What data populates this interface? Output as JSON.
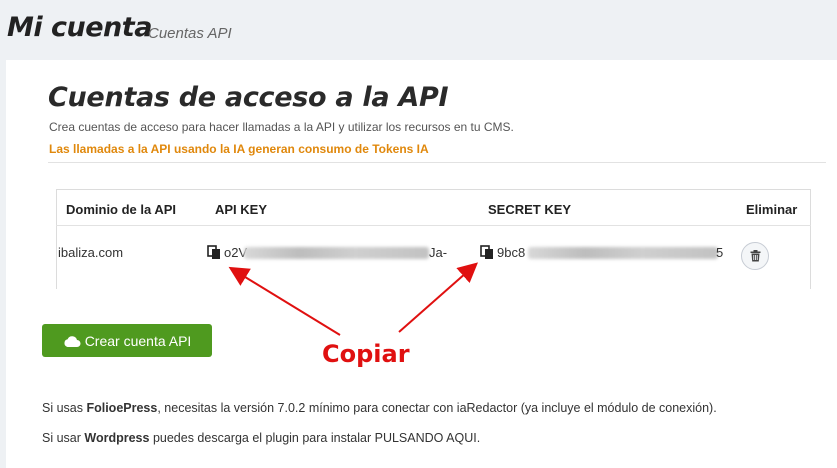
{
  "header": {
    "title": "Mi cuenta",
    "subtitle": "Cuentas API"
  },
  "section": {
    "title": "Cuentas de acceso a la API",
    "description": "Crea cuentas de acceso para hacer llamadas a la API y utilizar los recursos en tu CMS.",
    "warning": "Las llamadas a la API usando la IA generan consumo de Tokens IA"
  },
  "table": {
    "headers": {
      "domain": "Dominio de la API",
      "api_key": "API KEY",
      "secret_key": "SECRET KEY",
      "delete": "Eliminar"
    },
    "rows": [
      {
        "domain": "ibaliza.com",
        "api_key_start": "o2V",
        "api_key_end": "Ja-",
        "secret_key_start": "9bc8",
        "secret_key_end": "5"
      }
    ]
  },
  "create_button": {
    "label": "Crear cuenta API",
    "icon": "cloud-icon"
  },
  "annotation": {
    "label": "Copiar",
    "color": "#e01010"
  },
  "footer": {
    "line1_prefix": "Si usas ",
    "line1_bold": "FolioePress",
    "line1_suffix": ", necesitas la versión 7.0.2 mínimo para conectar con iaRedactor (ya incluye el módulo de conexión).",
    "line2_prefix": "Si usar ",
    "line2_bold": "Wordpress",
    "line2_suffix": " puedes descarga el plugin para instalar PULSANDO AQUI."
  },
  "colors": {
    "accent_green": "#4f9a1f",
    "warning_orange": "#e0880c",
    "background": "#eef1f4"
  }
}
